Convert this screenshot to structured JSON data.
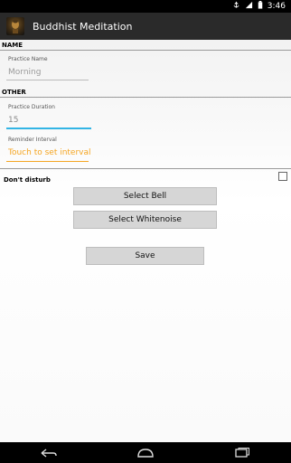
{
  "status": {
    "time": "3:46"
  },
  "app": {
    "title": "Buddhist Meditation"
  },
  "sections": {
    "name": "NAME",
    "other": "OTHER"
  },
  "practice_name": {
    "label": "Practice Name",
    "value": "Morning"
  },
  "practice_duration": {
    "label": "Practice Duration",
    "value": "15"
  },
  "reminder_interval": {
    "label": "Reminder Interval",
    "value": "Touch to set interval"
  },
  "dont_disturb": {
    "label": "Don't disturb",
    "checked": false
  },
  "buttons": {
    "select_bell": "Select Bell",
    "select_whitenoise": "Select Whitenoise",
    "save": "Save"
  },
  "colors": {
    "accent": "#f5a623",
    "focus_underline": "#33b5e5"
  }
}
